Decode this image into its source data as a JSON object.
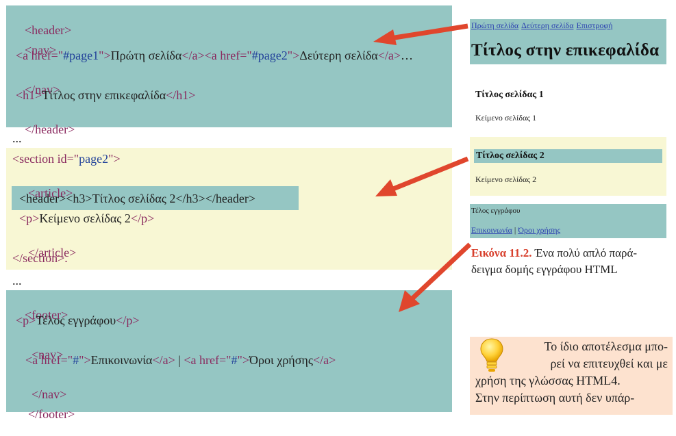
{
  "code": {
    "header_block": {
      "line1": {
        "open": "<header>"
      },
      "line2": {
        "open": "<nav>"
      },
      "line3": {
        "a1_open_start": "<a href=\"",
        "a1_href": "#page1",
        "a1_open_end": "\">",
        "a1_text": "Πρώτη σελίδα",
        "a1_close": "</a>",
        "a2_open_start": "<a href=\"",
        "a2_href": "#page2",
        "a2_open_end": "\">",
        "a2_text": "Δεύτερη σελίδα",
        "a2_close": "</a>",
        "ellipsis": "…"
      },
      "line4": {
        "close": "</nav>"
      },
      "line5": {
        "open": "<h1>",
        "text": "Τίτλος στην επικεφαλίδα",
        "close": "</h1>"
      },
      "line6": {
        "close": "</header>"
      }
    },
    "dots1": "...",
    "section_block": {
      "line1": {
        "open_start": "<section id=\"",
        "id": "page2",
        "open_end": "\">"
      },
      "line2": {
        "open": "<article>"
      },
      "line3": {
        "header_open": "<header>",
        "h3_open": "<h3>",
        "text": "Τίτλος σελίδας 2",
        "h3_close": "</h3>",
        "header_close": "</header>"
      },
      "line4": {
        "open": "<p>",
        "text": "Κείμενο σελίδας 2",
        "close": "</p>"
      },
      "line5": {
        "close": "</article>"
      },
      "line6": {
        "close": "</section>",
        "suffix": "."
      }
    },
    "dots2": "...",
    "footer_block": {
      "line1": {
        "open": "<footer>"
      },
      "line2": {
        "open": "<p>",
        "text": "Τέλος εγγράφου",
        "close": "</p>"
      },
      "line3": {
        "open": "<nav>"
      },
      "line4": {
        "a1_open_start": "<a href=\"",
        "a1_href": "#",
        "a1_open_end": "\">",
        "a1_text": "Επικοινωνία",
        "a1_close": "</a>",
        "sep": " | ",
        "a2_open_start": "<a href=\"",
        "a2_href": "#",
        "a2_open_end": "\">",
        "a2_text": "Όροι χρήσης",
        "a2_close": "</a>"
      },
      "line5": {
        "close": "</nav>"
      },
      "line6": {
        "close": "</footer>"
      }
    }
  },
  "preview": {
    "nav_links": [
      "Πρώτη σελίδα",
      "Δεύτερη σελίδα",
      "Επιστροφή"
    ],
    "h1": "Τίτλος στην επικεφαλίδα",
    "page1_title": "Τίτλος σελίδας 1",
    "page1_text": "Κείμενο σελίδας 1",
    "page2_title": "Τίτλος σελίδας 2",
    "page2_text": "Κείμενο σελίδας 2",
    "footer_text": "Τέλος εγγράφου",
    "footer_links": [
      "Επικοινωνία",
      "Όροι χρήσης"
    ],
    "footer_sep": "|"
  },
  "caption": {
    "label": "Εικόνα 11.2.",
    "text_line1": "Ένα πολύ απλό παρά-",
    "text_line2": "δειγμα δομής εγγράφου HTML"
  },
  "tip": {
    "icon": "lightbulb-icon",
    "line1": "Το ίδιο αποτέλεσμα μπο-",
    "line2": "ρεί να επιτευχθεί και με",
    "line3": "χρήση της γλώσσας HTML4.",
    "line4": "Στην περίπτωση αυτή δεν υπάρ-"
  },
  "colors": {
    "teal": "#95c6c3",
    "cream": "#f8f7d4",
    "tag": "#8a2a5f",
    "attr_value": "#22429a",
    "arrow": "#e0462d",
    "caption_label": "#d8402d",
    "tip_bg": "#fde2cf"
  }
}
